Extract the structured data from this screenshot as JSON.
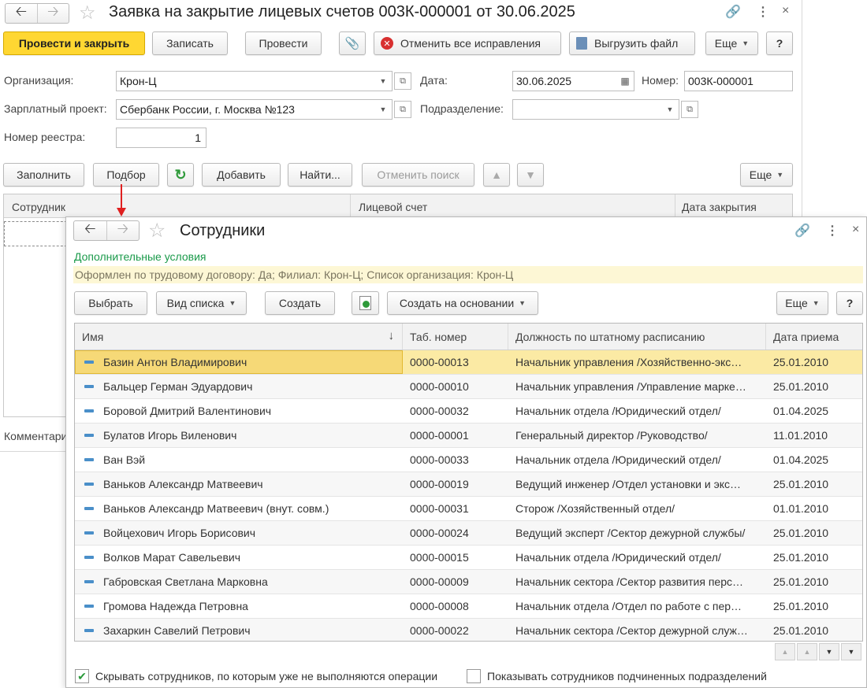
{
  "main": {
    "title": "Заявка на закрытие лицевых счетов 003К-000001 от 30.06.2025",
    "toolbar": {
      "post_close": "Провести и закрыть",
      "save": "Записать",
      "post": "Провести",
      "cancel_corrections": "Отменить все исправления",
      "export_file": "Выгрузить файл",
      "more": "Еще",
      "help": "?"
    },
    "form": {
      "org_label": "Организация:",
      "org_value": "Крон-Ц",
      "date_label": "Дата:",
      "date_value": "30.06.2025",
      "number_label": "Номер:",
      "number_value": "003К-000001",
      "project_label": "Зарплатный проект:",
      "project_value": "Сбербанк России, г. Москва №123",
      "dept_label": "Подразделение:",
      "dept_value": "",
      "registry_label": "Номер реестра:",
      "registry_value": "1"
    },
    "table_toolbar": {
      "fill": "Заполнить",
      "pick": "Подбор",
      "add": "Добавить",
      "find": "Найти...",
      "cancel_search": "Отменить поиск",
      "more": "Еще"
    },
    "table_headers": [
      "Сотрудник",
      "Лицевой счет",
      "Дата закрытия"
    ],
    "comment_label": "Комментарий:"
  },
  "dialog": {
    "title": "Сотрудники",
    "conditions_title": "Дополнительные условия",
    "conditions_text": "Оформлен по трудовому договору: Да; Филиал: Крон-Ц; Список организация: Крон-Ц",
    "toolbar": {
      "select": "Выбрать",
      "list_view": "Вид списка",
      "create": "Создать",
      "create_based": "Создать на основании",
      "more": "Еще",
      "help": "?"
    },
    "columns": [
      "Имя",
      "Таб. номер",
      "Должность по штатному расписанию",
      "Дата приема"
    ],
    "rows": [
      {
        "name": "Базин Антон Владимирович",
        "tab": "0000-00013",
        "position": "Начальник управления /Хозяйственно-экс…",
        "date": "25.01.2010"
      },
      {
        "name": "Бальцер Герман Эдуардович",
        "tab": "0000-00010",
        "position": "Начальник управления /Управление марке…",
        "date": "25.01.2010"
      },
      {
        "name": "Боровой Дмитрий Валентинович",
        "tab": "0000-00032",
        "position": "Начальник отдела /Юридический отдел/",
        "date": "01.04.2025"
      },
      {
        "name": "Булатов Игорь Виленович",
        "tab": "0000-00001",
        "position": "Генеральный директор /Руководство/",
        "date": "11.01.2010"
      },
      {
        "name": "Ван Вэй",
        "tab": "0000-00033",
        "position": "Начальник отдела /Юридический отдел/",
        "date": "01.04.2025"
      },
      {
        "name": "Ваньков Александр Матвеевич",
        "tab": "0000-00019",
        "position": "Ведущий инженер /Отдел установки и экс…",
        "date": "25.01.2010"
      },
      {
        "name": "Ваньков Александр Матвеевич (внут. совм.)",
        "tab": "0000-00031",
        "position": "Сторож /Хозяйственный отдел/",
        "date": "01.01.2010"
      },
      {
        "name": "Войцехович Игорь Борисович",
        "tab": "0000-00024",
        "position": "Ведущий эксперт /Сектор дежурной службы/",
        "date": "25.01.2010"
      },
      {
        "name": "Волков Марат Савельевич",
        "tab": "0000-00015",
        "position": "Начальник отдела /Юридический отдел/",
        "date": "25.01.2010"
      },
      {
        "name": "Габровская Светлана Марковна",
        "tab": "0000-00009",
        "position": "Начальник сектора /Сектор развития перс…",
        "date": "25.01.2010"
      },
      {
        "name": "Громова Надежда Петровна",
        "tab": "0000-00008",
        "position": "Начальник отдела /Отдел по работе с пер…",
        "date": "25.01.2010"
      },
      {
        "name": "Захаркин Савелий Петрович",
        "tab": "0000-00022",
        "position": "Начальник сектора /Сектор дежурной служ…",
        "date": "25.01.2010"
      }
    ],
    "options": {
      "hide_inactive": "Скрывать сотрудников, по которым уже не выполняются операции",
      "hide_inactive_checked": true,
      "show_subordinate": "Показывать сотрудников подчиненных подразделений",
      "show_subordinate_checked": false
    }
  },
  "colors": {
    "primary_button": "#ffd732",
    "selected_row": "#fbeaa4",
    "conditions_title": "#1a9a4a",
    "conditions_bg": "#fdf7d5",
    "annotation_arrow": "#e02020"
  }
}
